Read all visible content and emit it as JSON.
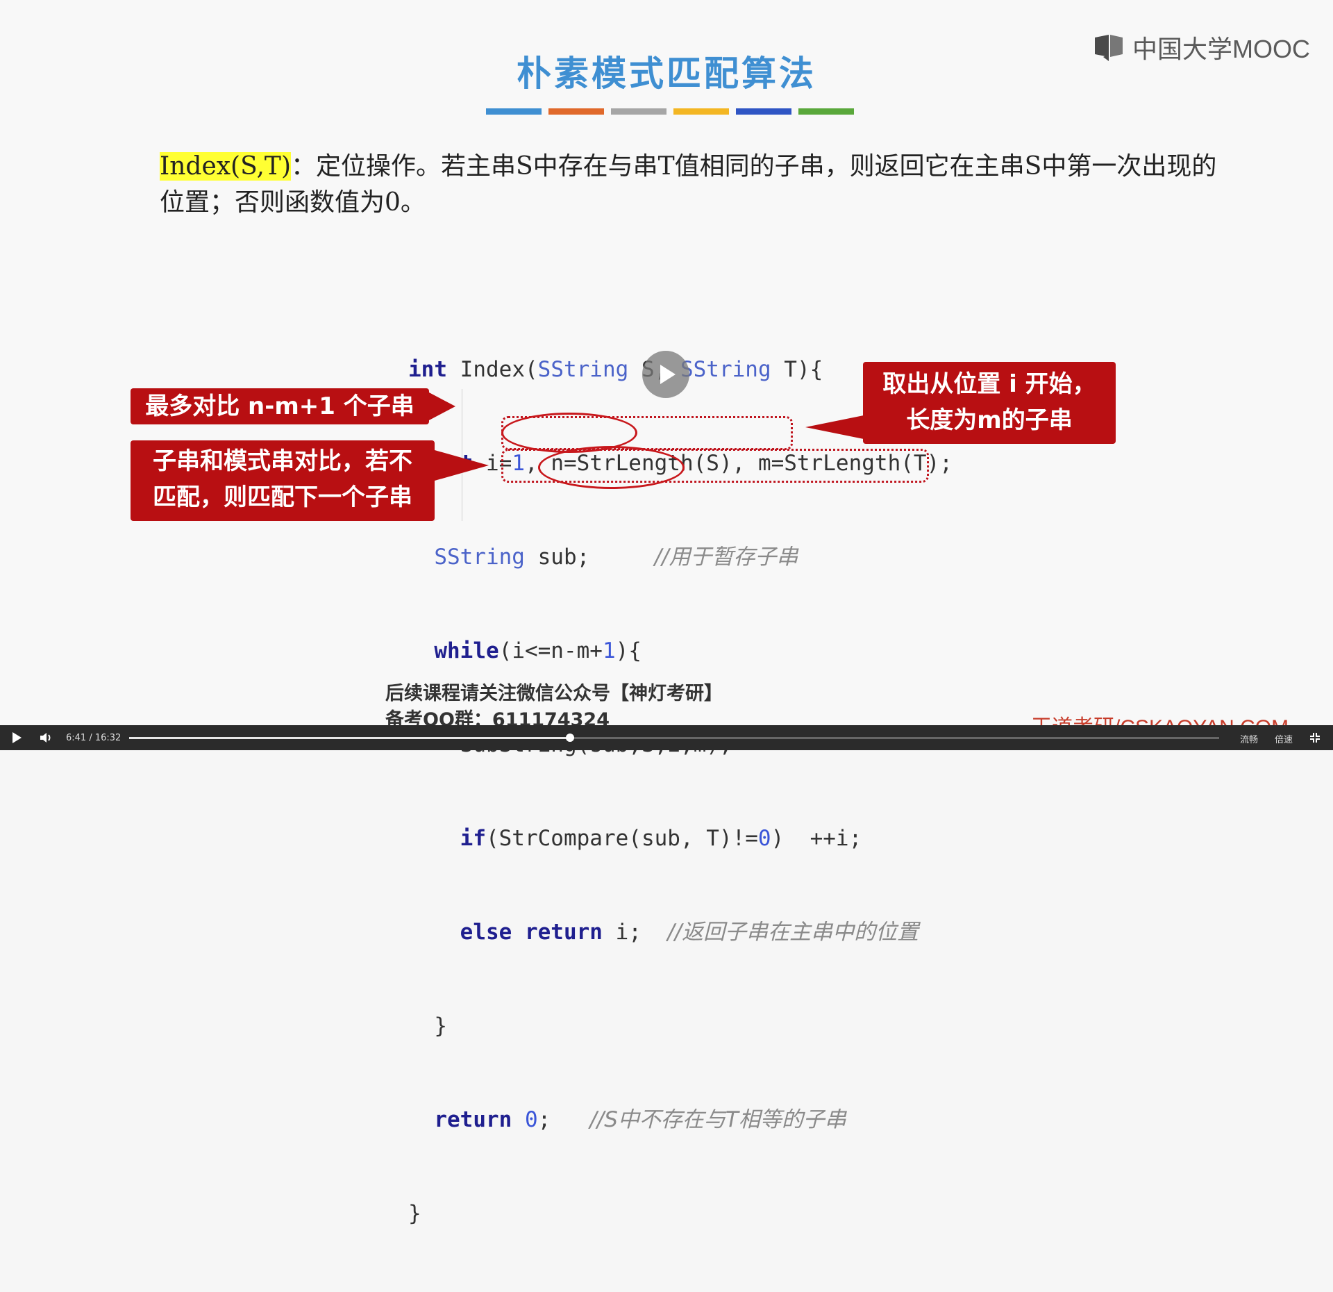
{
  "slide": {
    "title": "朴素模式匹配算法",
    "colorbars": [
      "#3f8fd2",
      "#e0692b",
      "#a6a6a6",
      "#f3b623",
      "#2f55c4",
      "#5aa83b"
    ],
    "logo": "中国大学MOOC",
    "desc_fn": "Index(S,T)",
    "desc_rest": "：定位操作。若主串S中存在与串T值相同的子串，则返回它在主串S中第一次出现的位置；否则函数值为0。",
    "code": {
      "l1_kw": "int",
      "l1_a": " Index(",
      "l1_t1": "SString",
      "l1_b": " S, ",
      "l1_t2": "SString",
      "l1_c": " T){",
      "l2_kw": "int",
      "l2_a": " i=",
      "l2_n": "1",
      "l2_b": ", n=StrLength(S), m=StrLength(T);",
      "l3_t": "SString",
      "l3_a": " sub;",
      "l3_cm": "//用于暂存子串",
      "l4_kw": "while",
      "l4_a": "(i<=n-m+",
      "l4_n": "1",
      "l4_b": "){",
      "l5": "SubString(sub,S,i,m);",
      "l6_kw": "if",
      "l6_a": "(StrCompare(sub, T)!=",
      "l6_n": "0",
      "l6_b": ")  ++i;",
      "l7_kw1": "else",
      "l7_kw2": "return",
      "l7_a": " i;",
      "l7_cm": "//返回子串在主串中的位置",
      "l8": "}",
      "l9_kw": "return",
      "l9_n": "0",
      "l9_a": ";",
      "l9_cm": "//S中不存在与T相等的子串",
      "l10": "}"
    },
    "callout_left1": "最多对比 n-m+1 个子串",
    "callout_left2a": "子串和模式串对比，若不",
    "callout_left2b": "匹配，则匹配下一个子串",
    "callout_right_a": "取出从位置 i 开始，",
    "callout_right_b": "长度为m的子串",
    "notice_1": "后续课程请关注微信公众号【神灯考研】",
    "notice_2": "备考QQ群：611174324",
    "watermark": "王道考研/CSKAOYAN.COM"
  },
  "player": {
    "time": "6:41 / 16:32",
    "progress": 0.4043,
    "btn_quality": "流畅",
    "btn_speed": "倍速"
  }
}
